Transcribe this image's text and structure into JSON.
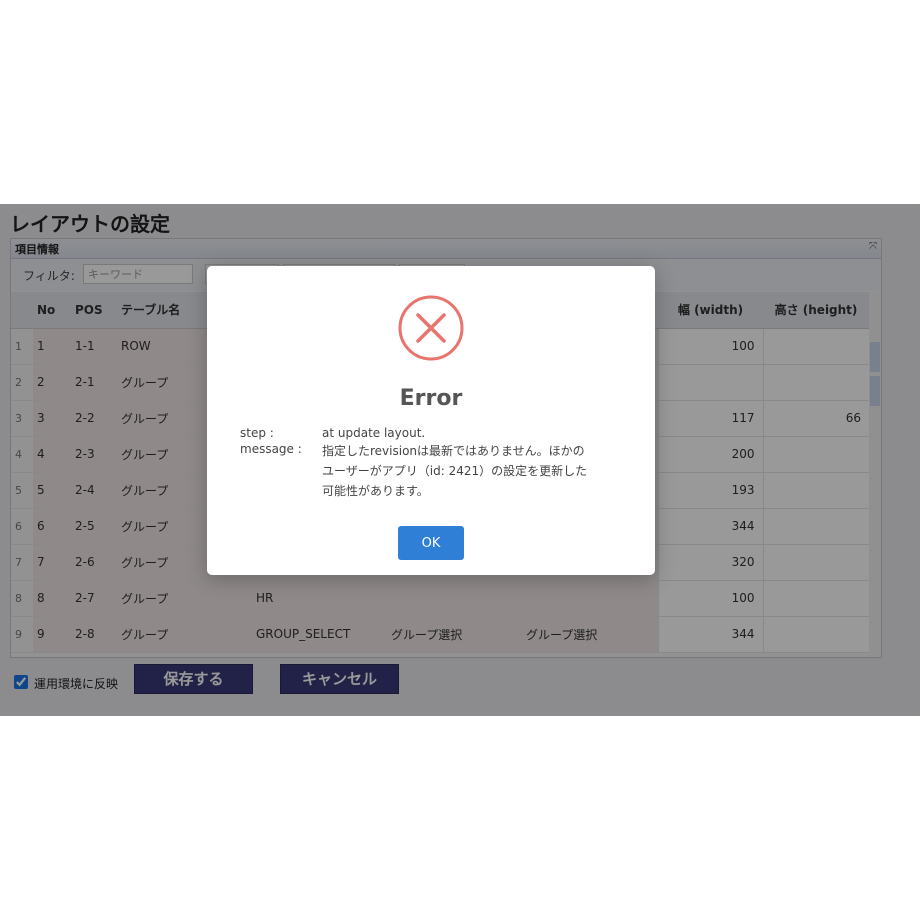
{
  "page": {
    "title": "レイアウトの設定"
  },
  "panel": {
    "title": "項目情報",
    "filter_label": "フィルタ:",
    "filter_placeholder": "キーワード"
  },
  "table": {
    "columns": [
      "No",
      "POS",
      "テーブル名",
      "幅 (width)",
      "高さ (height)"
    ],
    "rows": [
      {
        "rownum": "1",
        "no": "1",
        "pos": "1-1",
        "name": "ROW",
        "field": "",
        "label1": "",
        "label2": "",
        "width": "100",
        "height": ""
      },
      {
        "rownum": "2",
        "no": "2",
        "pos": "2-1",
        "name": "グループ",
        "field": "",
        "label1": "",
        "label2": "",
        "width": "",
        "height": ""
      },
      {
        "rownum": "3",
        "no": "3",
        "pos": "2-2",
        "name": "グループ",
        "field": "",
        "label1": "",
        "label2": "",
        "width": "117",
        "height": "66"
      },
      {
        "rownum": "4",
        "no": "4",
        "pos": "2-3",
        "name": "グループ",
        "field": "",
        "label1": "",
        "label2": "",
        "width": "200",
        "height": ""
      },
      {
        "rownum": "5",
        "no": "5",
        "pos": "2-4",
        "name": "グループ",
        "field": "",
        "label1": "",
        "label2": "",
        "width": "193",
        "height": ""
      },
      {
        "rownum": "6",
        "no": "6",
        "pos": "2-5",
        "name": "グループ",
        "field": "",
        "label1": "",
        "label2": "",
        "width": "344",
        "height": ""
      },
      {
        "rownum": "7",
        "no": "7",
        "pos": "2-6",
        "name": "グループ",
        "field": "",
        "label1": "",
        "label2": "",
        "width": "320",
        "height": ""
      },
      {
        "rownum": "8",
        "no": "8",
        "pos": "2-7",
        "name": "グループ",
        "field": "HR",
        "label1": "",
        "label2": "",
        "width": "100",
        "height": ""
      },
      {
        "rownum": "9",
        "no": "9",
        "pos": "2-8",
        "name": "グループ",
        "field": "GROUP_SELECT",
        "label1": "グループ選択",
        "label2": "グループ選択",
        "width": "344",
        "height": ""
      }
    ]
  },
  "footer": {
    "apply_label": "運用環境に反映",
    "save_label": "保存する",
    "cancel_label": "キャンセル"
  },
  "modal": {
    "title": "Error",
    "step_key": "step :",
    "step_value": "at update layout.",
    "message_key": "message :",
    "message_line1": "指定したrevisionは最新ではありません。ほかの",
    "message_line2": "ユーザーがアプリ（id: 2421）の設定を更新した",
    "message_line3": "可能性があります。",
    "ok_label": "OK",
    "icon": "error-x-icon",
    "icon_color": "#e8746e"
  }
}
